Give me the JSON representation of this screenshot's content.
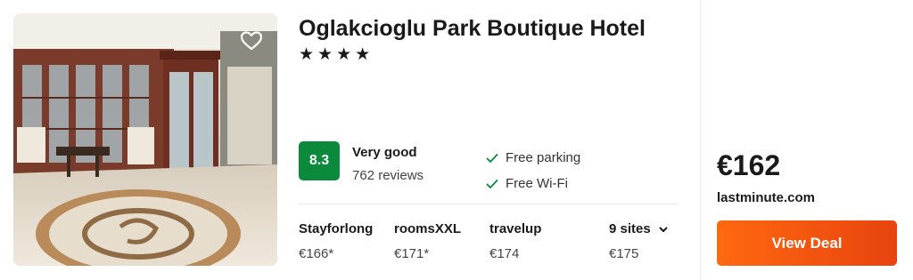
{
  "hotel": {
    "name": "Oglakcioglu Park Boutique Hotel",
    "stars": "★★★★",
    "favorite_icon": "heart-outline-icon"
  },
  "rating": {
    "score": "8.3",
    "label": "Very good",
    "reviews": "762 reviews",
    "badge_color": "#0b8a3c"
  },
  "amenities": [
    {
      "icon": "check-icon",
      "label": "Free parking"
    },
    {
      "icon": "check-icon",
      "label": "Free Wi-Fi"
    }
  ],
  "deals": [
    {
      "site": "Stayforlong",
      "price": "€166*"
    },
    {
      "site": "roomsXXL",
      "price": "€171*"
    },
    {
      "site": "travelup",
      "price": "€174"
    }
  ],
  "more_sites": {
    "label": "9 sites",
    "price": "€175",
    "icon": "chevron-down-icon"
  },
  "best_offer": {
    "price": "€162",
    "provider": "lastminute.com",
    "button_label": "View Deal",
    "button_color": "#ff690f"
  }
}
